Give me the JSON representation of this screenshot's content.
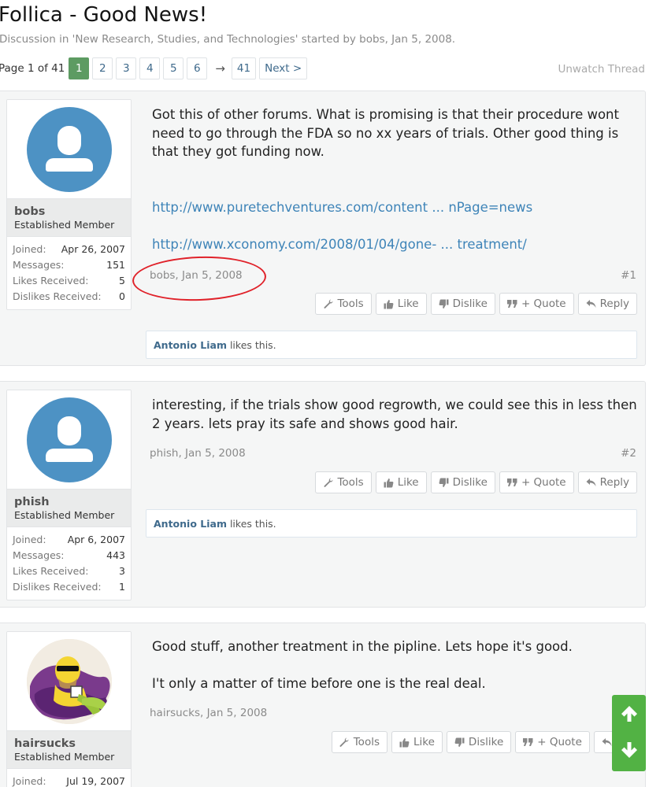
{
  "thread": {
    "title": "Follica - Good News!",
    "description": "Discussion in 'New Research, Studies, and Technologies' started by bobs, Jan 5, 2008."
  },
  "pagination": {
    "label": "Page 1 of 41",
    "pages": [
      "1",
      "2",
      "3",
      "4",
      "5",
      "6"
    ],
    "current": "1",
    "arrow": "→",
    "last": "41",
    "next": "Next >"
  },
  "unwatch_label": "Unwatch Thread",
  "stat_labels": {
    "joined": "Joined:",
    "messages": "Messages:",
    "likes": "Likes Received:",
    "dislikes": "Dislikes Received:"
  },
  "actions": {
    "tools": "Tools",
    "like": "Like",
    "dislike": "Dislike",
    "quote": "+ Quote",
    "reply": "Reply",
    "reply_partial": "Re"
  },
  "likes_suffix": "likes this.",
  "posts": [
    {
      "username": "bobs",
      "user_title": "Established Member",
      "joined": "Apr 26, 2007",
      "messages": "151",
      "likes": "5",
      "dislikes": "0",
      "lines": [
        "Got this of other forums. What is promising is that their procedure wont",
        "need to go through the FDA so no xx years of trials. Other good thing is",
        "that they got funding now."
      ],
      "links": [
        "http://www.puretechventures.com/content ... nPage=news",
        "http://www.xconomy.com/2008/01/04/gone- ... treatment/"
      ],
      "meta": "bobs, Jan 5, 2008",
      "number": "#1",
      "liker": "Antonio Liam"
    },
    {
      "username": "phish",
      "user_title": "Established Member",
      "joined": "Apr 6, 2007",
      "messages": "443",
      "likes": "3",
      "dislikes": "1",
      "lines": [
        "interesting, if the trials show good regrowth, we could see this in less then",
        "2 years. lets pray its safe and shows good hair."
      ],
      "meta": "phish, Jan 5, 2008",
      "number": "#2",
      "liker": "Antonio Liam"
    },
    {
      "username": "hairsucks",
      "user_title": "Established Member",
      "joined": "Jul 19, 2007",
      "lines": [
        "Good stuff, another treatment in the pipline. Lets hope it's good.",
        "I't only a matter of time before one is the real deal."
      ],
      "meta": "hairsucks, Jan 5, 2008"
    }
  ],
  "colors": {
    "page_current": "#5d9b62",
    "link": "#3e84b8",
    "avatar": "#4d92c4",
    "annotation": "#e0222a",
    "scroll_button": "#52b244"
  },
  "icons": {
    "tools": "wrench-icon",
    "like": "thumbs-up-icon",
    "dislike": "thumbs-down-icon",
    "quote": "quote-icon",
    "reply": "reply-icon",
    "scroll_up": "arrow-up-icon",
    "scroll_down": "arrow-down-icon"
  }
}
